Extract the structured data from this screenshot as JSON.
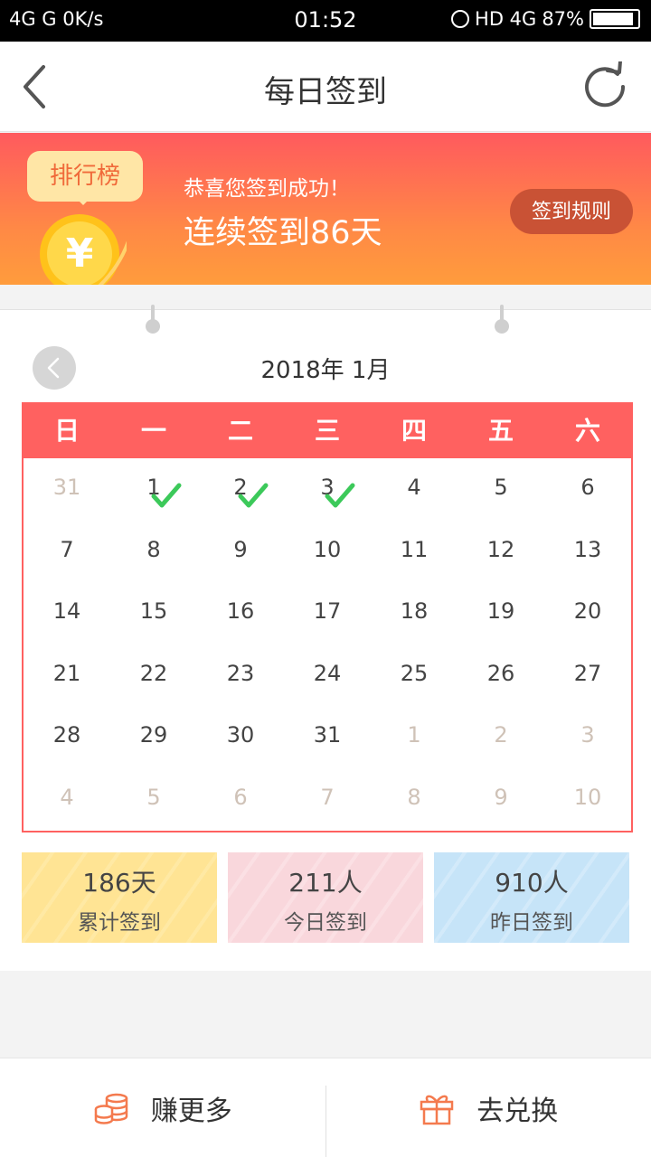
{
  "status_bar": {
    "left": "4G  G  0K/s",
    "time": "01:52",
    "network": "HD 4G",
    "battery": "87%"
  },
  "header": {
    "title": "每日签到"
  },
  "banner": {
    "rank_tag": "排行榜",
    "message": "恭喜您签到成功！",
    "streak": "连续签到86天",
    "rules_button": "签到规则"
  },
  "calendar": {
    "month_title": "2018年 1月",
    "weekdays": [
      "日",
      "一",
      "二",
      "三",
      "四",
      "五",
      "六"
    ],
    "weeks": [
      [
        {
          "d": "31",
          "m": true
        },
        {
          "d": "1",
          "c": true
        },
        {
          "d": "2",
          "c": true
        },
        {
          "d": "3",
          "c": true
        },
        {
          "d": "4"
        },
        {
          "d": "5"
        },
        {
          "d": "6"
        }
      ],
      [
        {
          "d": "7"
        },
        {
          "d": "8"
        },
        {
          "d": "9"
        },
        {
          "d": "10"
        },
        {
          "d": "11"
        },
        {
          "d": "12"
        },
        {
          "d": "13"
        }
      ],
      [
        {
          "d": "14"
        },
        {
          "d": "15"
        },
        {
          "d": "16"
        },
        {
          "d": "17"
        },
        {
          "d": "18"
        },
        {
          "d": "19"
        },
        {
          "d": "20"
        }
      ],
      [
        {
          "d": "21"
        },
        {
          "d": "22"
        },
        {
          "d": "23"
        },
        {
          "d": "24"
        },
        {
          "d": "25"
        },
        {
          "d": "26"
        },
        {
          "d": "27"
        }
      ],
      [
        {
          "d": "28"
        },
        {
          "d": "29"
        },
        {
          "d": "30"
        },
        {
          "d": "31"
        },
        {
          "d": "1",
          "m": true
        },
        {
          "d": "2",
          "m": true
        },
        {
          "d": "3",
          "m": true
        }
      ],
      [
        {
          "d": "4",
          "m": true
        },
        {
          "d": "5",
          "m": true
        },
        {
          "d": "6",
          "m": true
        },
        {
          "d": "7",
          "m": true
        },
        {
          "d": "8",
          "m": true
        },
        {
          "d": "9",
          "m": true
        },
        {
          "d": "10",
          "m": true
        }
      ]
    ]
  },
  "stats": [
    {
      "value": "186天",
      "label": "累计签到"
    },
    {
      "value": "211人",
      "label": "今日签到"
    },
    {
      "value": "910人",
      "label": "昨日签到"
    }
  ],
  "bottom_bar": {
    "earn_label": "赚更多",
    "exchange_label": "去兑换"
  },
  "colors": {
    "accent": "#ff6160",
    "check": "#3cc95a",
    "rules_button": "#c95235"
  },
  "icons": {
    "back": "chevron-left-icon",
    "refresh": "refresh-icon",
    "coin": "yuan-coin-icon",
    "earn": "coin-stack-icon",
    "exchange": "gift-icon"
  }
}
